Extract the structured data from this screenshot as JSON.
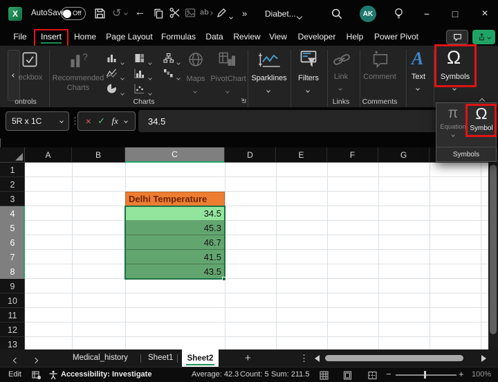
{
  "titlebar": {
    "autosave_label": "AutoSave",
    "autosave_state": "Off",
    "doc_name": "Diabet...",
    "avatar_initials": "AK"
  },
  "menubar": {
    "items": [
      "File",
      "Insert",
      "Home",
      "Page Layout",
      "Formulas",
      "Data",
      "Review",
      "View",
      "Developer",
      "Help",
      "Power Pivot"
    ],
    "active_item": "Insert"
  },
  "ribbon": {
    "controls": {
      "button_label": "eckbox",
      "group_label": "ontrols"
    },
    "charts": {
      "recommended_line1": "Recommended",
      "recommended_line2": "Charts",
      "group_label": "Charts",
      "maps_label": "Maps",
      "pivotchart_label": "PivotChart",
      "icon_names": [
        "column-chart",
        "treemap",
        "hierarchy",
        "line-chart",
        "histogram",
        "waterfall",
        "pie-chart",
        "scatter"
      ]
    },
    "sparklines_label": "Sparklines",
    "filters_label": "Filters",
    "links": {
      "button_label": "Link",
      "group_label": "Links"
    },
    "comments": {
      "button_label": "Comment",
      "group_label": "Comments"
    },
    "text_label": "Text",
    "symbols_label": "Symbols"
  },
  "symbols_menu": {
    "equation_label": "Equation",
    "symbol_label": "Symbol",
    "footer_label": "Symbols"
  },
  "formula_bar": {
    "name_box": "5R x 1C",
    "fx_label": "fx",
    "value": "34.5"
  },
  "grid": {
    "columns": [
      "A",
      "B",
      "C",
      "D",
      "E",
      "F",
      "G"
    ],
    "selected_column": "C",
    "rows": [
      "1",
      "2",
      "3",
      "4",
      "5",
      "6",
      "7",
      "8",
      "9",
      "10",
      "11",
      "12",
      "13"
    ],
    "selected_rows": [
      "4",
      "5",
      "6",
      "7",
      "8"
    ],
    "header_cell": {
      "text": "Delhi Temperature"
    },
    "values": [
      "34.5",
      "45.3",
      "46.7",
      "41.5",
      "43.5"
    ]
  },
  "sheetbar": {
    "tabs": [
      "Medical_history",
      "Sheet1",
      "Sheet2"
    ],
    "active_tab": "Sheet2"
  },
  "statusbar": {
    "mode": "Edit",
    "accessibility": "Accessibility: Investigate",
    "average": "Average: 42.3",
    "count": "Count: 5",
    "sum": "Sum: 211.5",
    "zoom": "100%"
  },
  "icons": {
    "overflow": "»",
    "undo": "↺",
    "back": "←",
    "minimize": "−",
    "maximize": "□",
    "close": "×",
    "dots_vertical": "⋮",
    "cancel": "×",
    "confirm": "✓",
    "pi": "π",
    "omega": "Ω",
    "text_a": "A",
    "add_sheet": "+",
    "ab": "ab"
  },
  "colors": {
    "accent_green": "#1A8F52",
    "highlight_red": "#E01414",
    "header_orange": "#ED7D31",
    "cell_green": "#93E59D",
    "cell_green_selected": "#63A56F",
    "selection_border": "#1B6F44",
    "text_blue": "#3F86C9"
  }
}
